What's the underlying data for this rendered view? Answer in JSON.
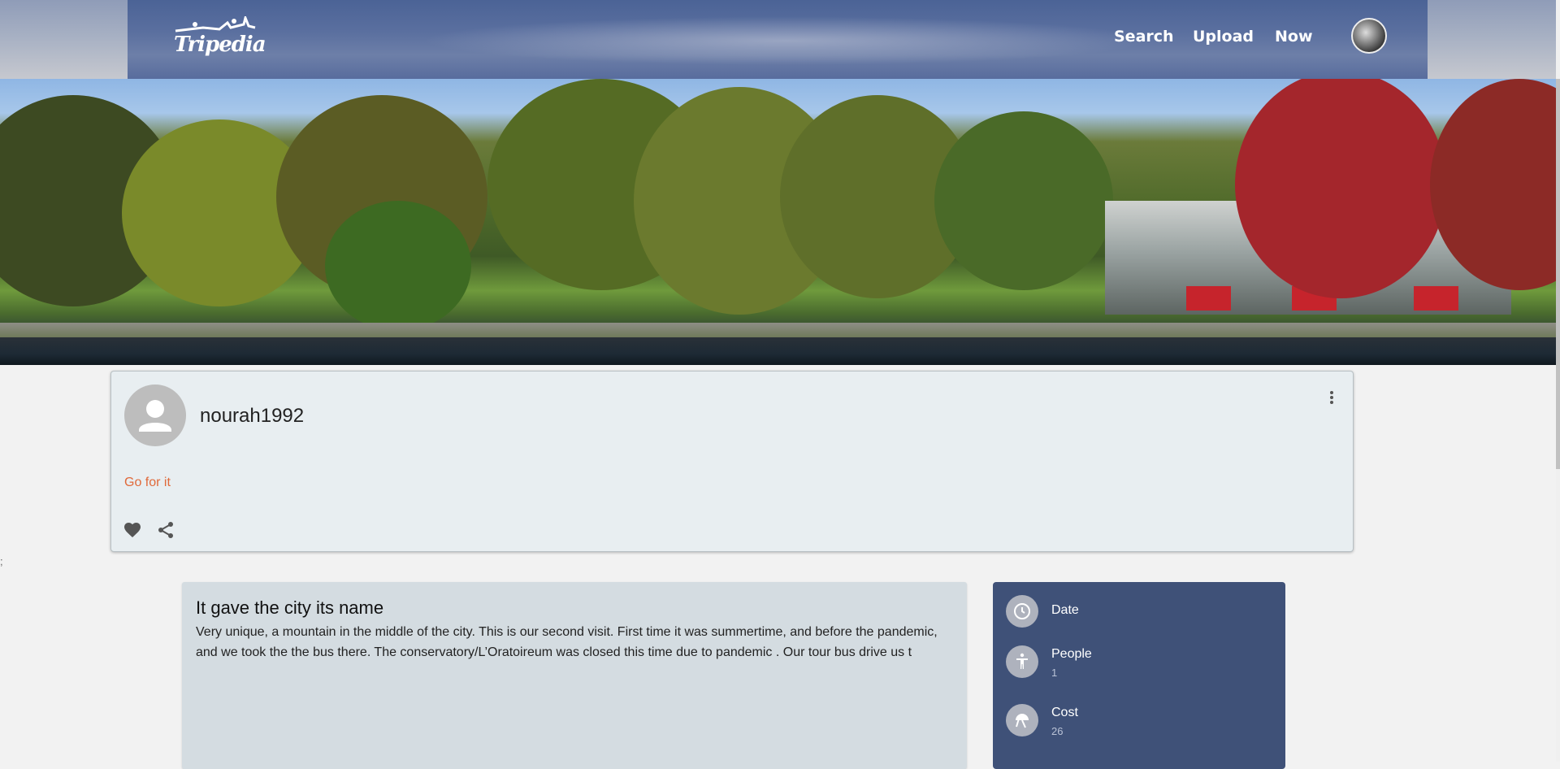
{
  "header": {
    "logo_text": "Tripedia",
    "nav": {
      "search": "Search",
      "upload": "Upload",
      "now": "Now"
    }
  },
  "post": {
    "username": "nourah1992",
    "tag": "Go for it"
  },
  "stray_text": ";",
  "review": {
    "title": "It gave the city its name",
    "body": "Very unique, a mountain in the middle of the city. This is our second visit. First time it was summertime, and before the pandemic, and we took the the bus there. The conservatory/L’Oratoireum was closed this time due to pandemic . Our tour bus drive us t"
  },
  "info": {
    "date_label": "Date",
    "people_label": "People",
    "people_value": "1",
    "cost_label": "Cost",
    "cost_value": "26"
  },
  "colors": {
    "header": "#4b6396",
    "info_panel": "#3f5178",
    "tag": "#e0693a",
    "post_card": "#e8eef1",
    "review_card": "#d4dce1"
  },
  "icons": [
    "more-vert-icon",
    "heart-icon",
    "share-icon",
    "clock-icon",
    "person-icon",
    "cost-icon",
    "user-placeholder-icon"
  ]
}
